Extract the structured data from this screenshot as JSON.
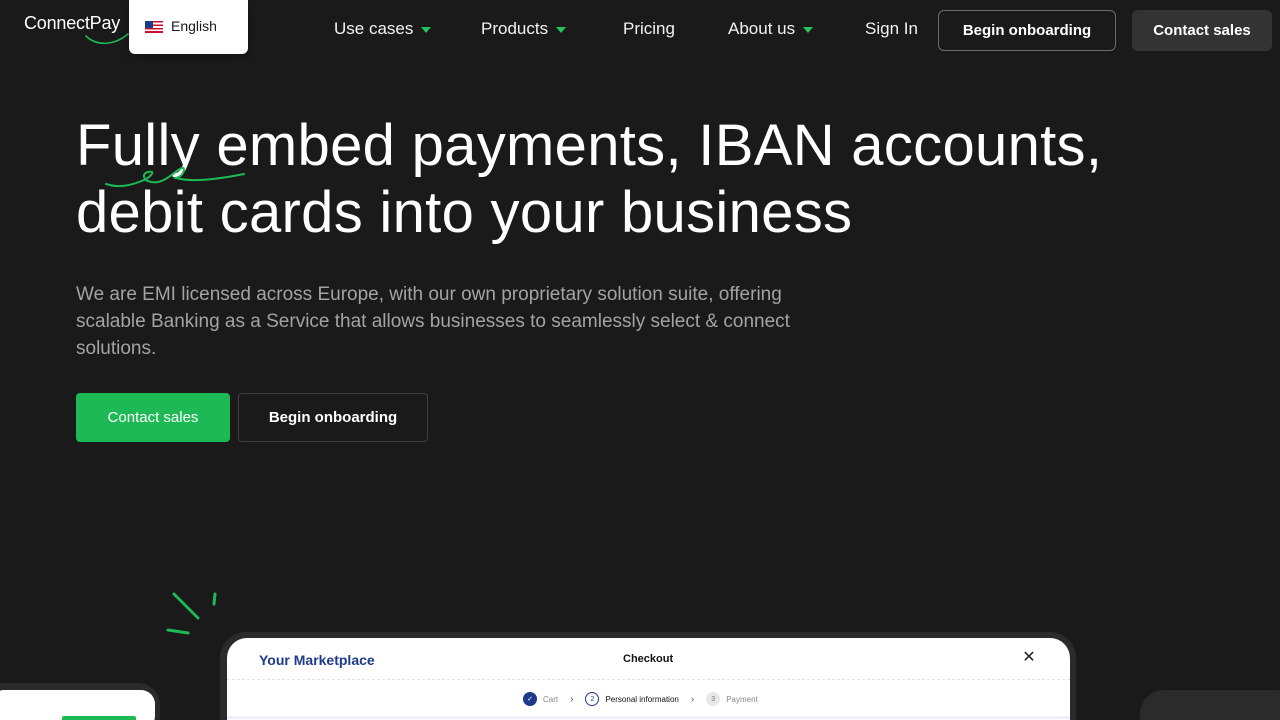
{
  "header": {
    "logo_text": "ConnectPay",
    "language": {
      "label": "English",
      "flag": "us-flag-icon"
    },
    "nav": [
      {
        "label": "Use cases",
        "has_dropdown": true
      },
      {
        "label": "Products",
        "has_dropdown": true
      },
      {
        "label": "Pricing",
        "has_dropdown": false
      },
      {
        "label": "About us",
        "has_dropdown": true
      }
    ],
    "sign_in": "Sign In",
    "begin_onboarding": "Begin onboarding",
    "contact_sales": "Contact sales"
  },
  "hero": {
    "title_line1": "Fully embed payments, IBAN accounts,",
    "title_line2": "debit cards into your business",
    "subtitle": "We are EMI licensed across Europe, with our own proprietary solution suite, offering scalable Banking as a Service that allows businesses to seamlessly select & connect solutions.",
    "cta_primary": "Contact sales",
    "cta_secondary": "Begin onboarding"
  },
  "mockup": {
    "marketplace_title": "Your Marketplace",
    "checkout_title": "Checkout",
    "close_symbol": "✕",
    "steps": [
      {
        "label": "Cart",
        "state": "done",
        "marker": "✓"
      },
      {
        "label": "Personal information",
        "state": "current",
        "marker": "2"
      },
      {
        "label": "Payment",
        "state": "pending",
        "marker": "3"
      }
    ],
    "step_separator": "›"
  },
  "colors": {
    "background": "#1a1a1a",
    "accent_green": "#1db954",
    "caret_green": "#22c55e",
    "brand_blue": "#1e3a8a",
    "subtitle_gray": "#a3a3a3"
  }
}
